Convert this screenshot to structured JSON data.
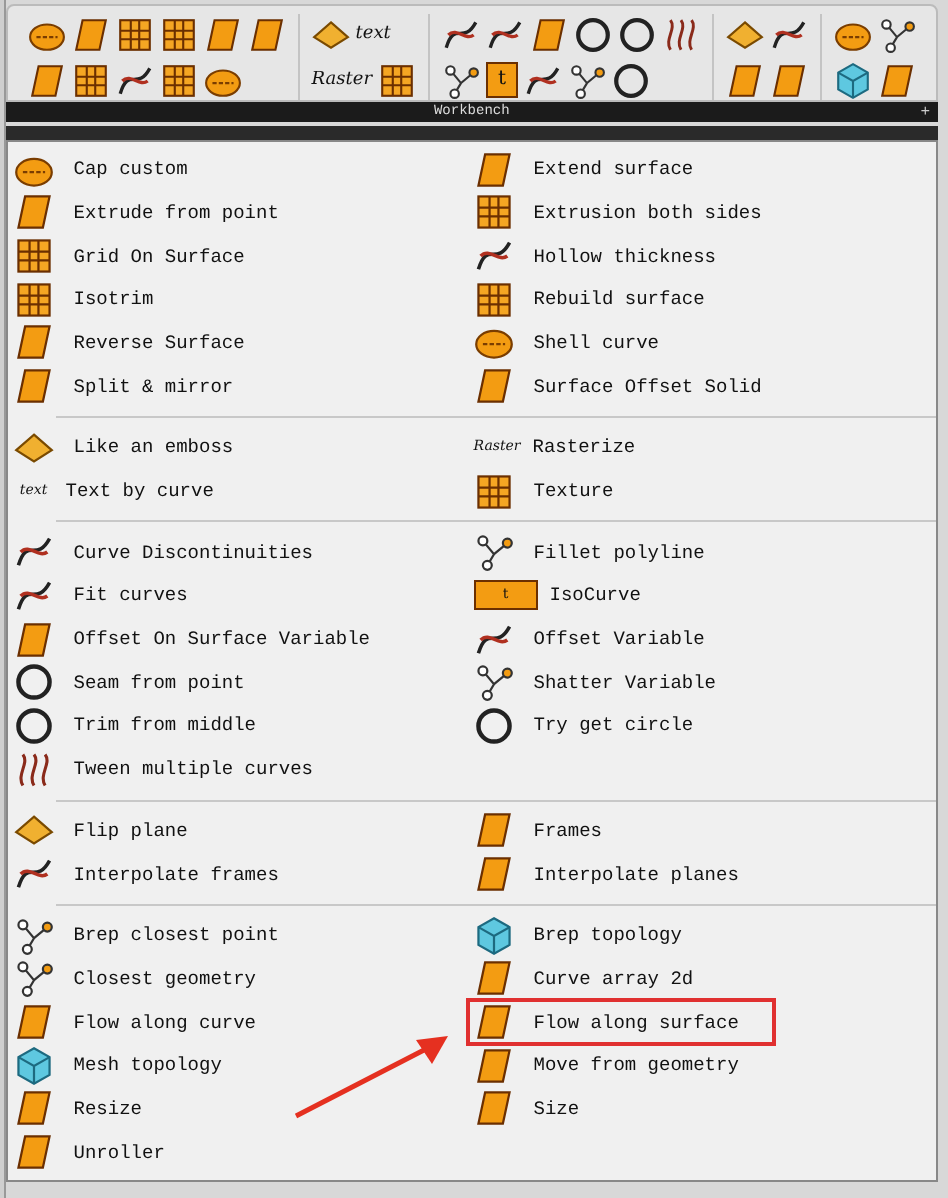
{
  "toolbar": {
    "text_icon": "text",
    "raster_icon": "Raster",
    "isocurve_icon": "t"
  },
  "workbench": {
    "title": "Workbench",
    "expand": "+"
  },
  "menu": {
    "sections": [
      {
        "left": [
          {
            "label": "Cap custom",
            "highlighted": false
          },
          {
            "label": "Extrude from point",
            "highlighted": false
          },
          {
            "label": "Grid On Surface",
            "highlighted": false
          },
          {
            "label": "Isotrim",
            "highlighted": false
          },
          {
            "label": "Reverse Surface",
            "highlighted": false
          },
          {
            "label": "Split & mirror",
            "highlighted": false
          }
        ],
        "right": [
          {
            "label": "Extend surface",
            "highlighted": false
          },
          {
            "label": "Extrusion both sides",
            "highlighted": false
          },
          {
            "label": "Hollow thickness",
            "highlighted": false
          },
          {
            "label": "Rebuild surface",
            "highlighted": false
          },
          {
            "label": "Shell curve",
            "highlighted": false
          },
          {
            "label": "Surface Offset Solid",
            "highlighted": false
          }
        ]
      },
      {
        "left": [
          {
            "label": "Like an emboss",
            "highlighted": false
          },
          {
            "label": "Text by curve",
            "icon_text": "text",
            "highlighted": false
          }
        ],
        "right": [
          {
            "label": "Rasterize",
            "icon_text": "Raster",
            "highlighted": false
          },
          {
            "label": "Texture",
            "highlighted": false
          }
        ]
      },
      {
        "left": [
          {
            "label": "Curve Discontinuities",
            "highlighted": false
          },
          {
            "label": "Fit curves",
            "highlighted": false
          },
          {
            "label": "Offset On Surface Variable",
            "highlighted": false
          },
          {
            "label": "Seam from point",
            "highlighted": false
          },
          {
            "label": "Trim from middle",
            "highlighted": false
          },
          {
            "label": "Tween multiple curves",
            "highlighted": false
          }
        ],
        "right": [
          {
            "label": "Fillet polyline",
            "highlighted": false
          },
          {
            "label": "IsoCurve",
            "icon_text": "t",
            "highlighted": false
          },
          {
            "label": "Offset Variable",
            "highlighted": false
          },
          {
            "label": "Shatter Variable",
            "highlighted": false
          },
          {
            "label": "Try get circle",
            "highlighted": false
          }
        ]
      },
      {
        "left": [
          {
            "label": "Flip plane",
            "highlighted": false
          },
          {
            "label": "Interpolate frames",
            "highlighted": false
          }
        ],
        "right": [
          {
            "label": "Frames",
            "highlighted": false
          },
          {
            "label": "Interpolate planes",
            "highlighted": false
          }
        ]
      },
      {
        "left": [
          {
            "label": "Brep closest point",
            "highlighted": false
          },
          {
            "label": "Closest geometry",
            "highlighted": false
          },
          {
            "label": "Flow along curve",
            "highlighted": false
          },
          {
            "label": "Mesh topology",
            "highlighted": false
          },
          {
            "label": "Resize",
            "highlighted": false
          },
          {
            "label": "Unroller",
            "highlighted": false
          }
        ],
        "right": [
          {
            "label": "Brep topology",
            "highlighted": false
          },
          {
            "label": "Curve array 2d",
            "highlighted": false
          },
          {
            "label": "Flow along surface",
            "highlighted": true
          },
          {
            "label": "Move from geometry",
            "highlighted": false
          },
          {
            "label": "Size",
            "highlighted": false
          }
        ]
      }
    ]
  }
}
